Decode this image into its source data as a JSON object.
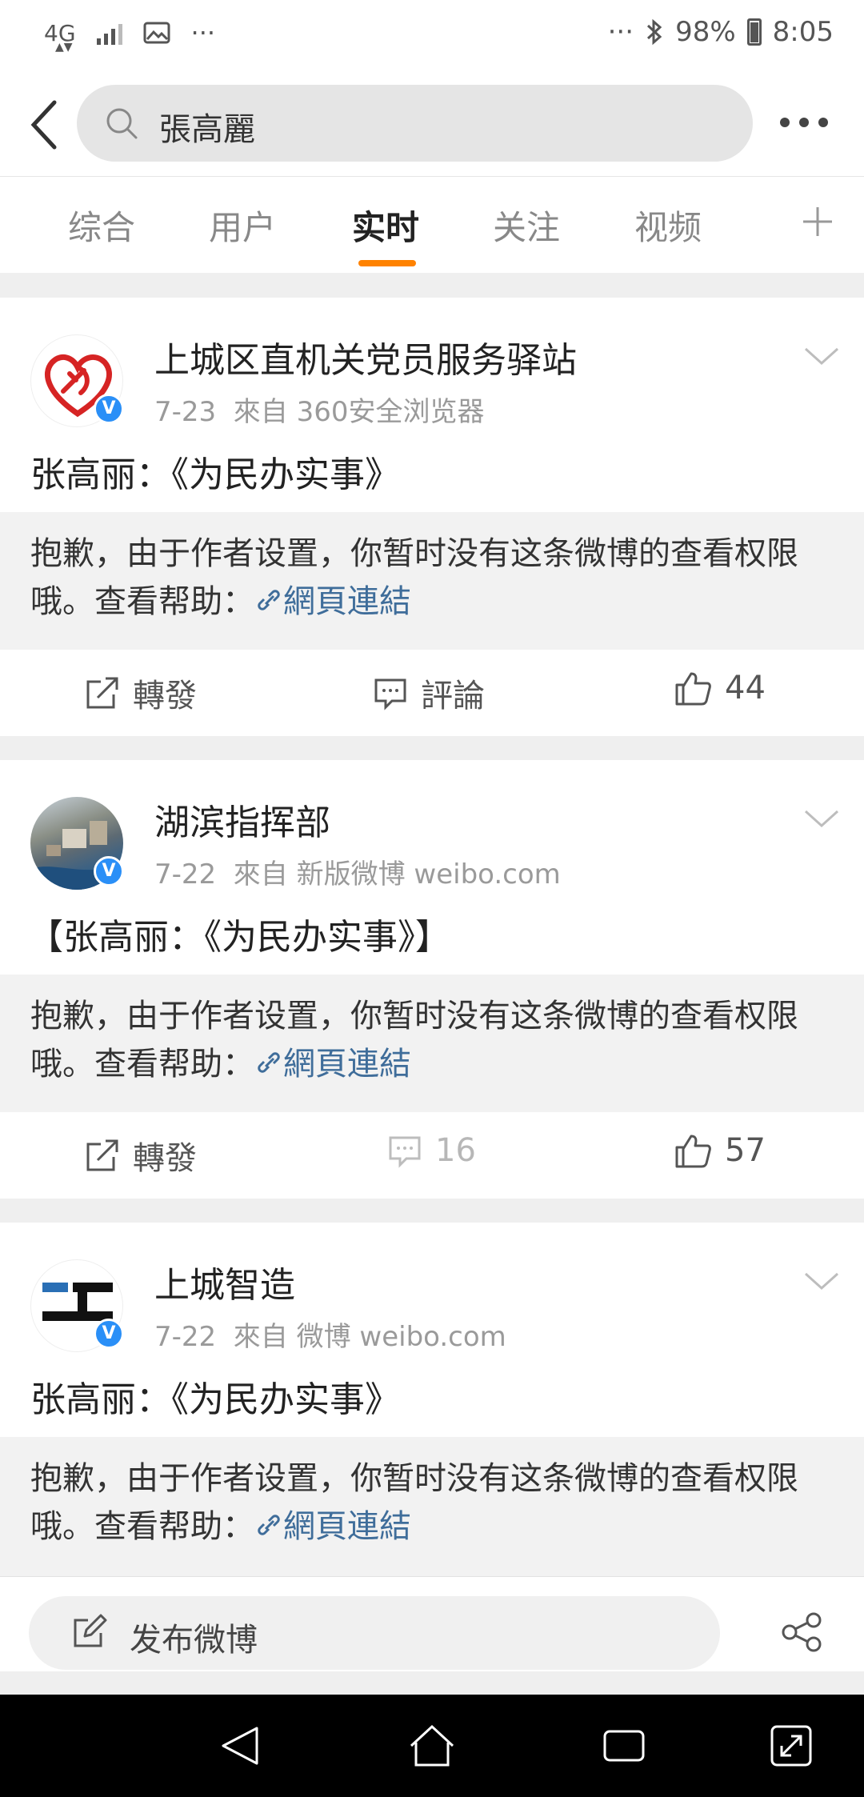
{
  "status_bar": {
    "network": "4G",
    "battery": "98%",
    "time": "8:05",
    "more_dots": "···"
  },
  "search": {
    "query": "張高麗"
  },
  "tabs": [
    {
      "label": "综合"
    },
    {
      "label": "用户"
    },
    {
      "label": "实时"
    },
    {
      "label": "关注"
    },
    {
      "label": "视频"
    }
  ],
  "active_tab": "实时",
  "accent_color": "#ff8200",
  "link_color": "#3f6d9a",
  "posts": [
    {
      "user": "上城区直机关党员服务驿站",
      "date": "7-23",
      "source": "來自 360安全浏览器",
      "text": "张高丽：《为民办实事》",
      "notice": "抱歉，由于作者设置，你暂时没有这条微博的查看权限哦。查看帮助：",
      "link": "網頁連結",
      "repost_label": "轉發",
      "comment_label": "評論",
      "likes": "44"
    },
    {
      "user": "湖滨指挥部",
      "date": "7-22",
      "source": "來自 新版微博 weibo.com",
      "text": "【张高丽：《为民办实事》】",
      "notice": "抱歉，由于作者设置，你暂时没有这条微博的查看权限哦。查看帮助：",
      "link": "網頁連結",
      "repost_label": "轉發",
      "comments": "16",
      "likes": "57"
    },
    {
      "user": "上城智造",
      "date": "7-22",
      "source": "來自 微博 weibo.com",
      "text": "张高丽：《为民办实事》",
      "notice": "抱歉，由于作者设置，你暂时没有这条微博的查看权限哦。查看帮助：",
      "link": "網頁連結"
    }
  ],
  "bottom": {
    "compose_label": "发布微博"
  },
  "icons": {
    "back": "back-arrow-icon",
    "search": "search-icon",
    "more": "more-icon",
    "add_tab": "plus-icon",
    "dropdown": "chevron-down-icon",
    "repost": "repost-icon",
    "comment": "comment-icon",
    "like": "thumbs-up-icon",
    "link": "link-icon",
    "compose": "edit-icon",
    "share": "share-icon",
    "verified": "verified-badge-icon"
  }
}
